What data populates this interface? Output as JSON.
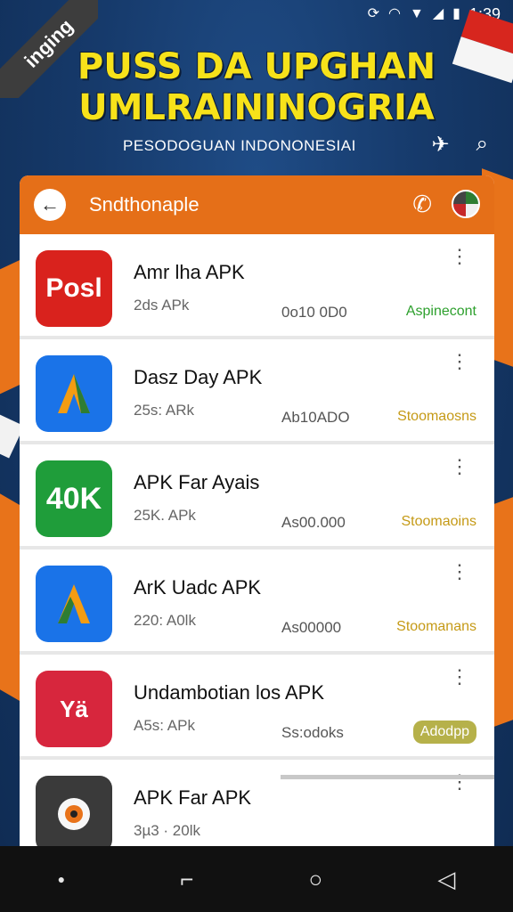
{
  "status_bar": {
    "time": "1:39"
  },
  "ribbon": {
    "label": "inging"
  },
  "hero": {
    "title_line1": "PUSS DA UPGHAN",
    "title_line2": "UMLRAININOGRIA",
    "subtitle": "PESODOGUAN INDONONESIAI"
  },
  "header": {
    "title": "Sndthonaple"
  },
  "apps": [
    {
      "name": "Amr lha APK",
      "size": "2ds APk",
      "date": "0o10 0D0",
      "status": "Aspinecont",
      "status_style": "green",
      "icon_text": "Posl",
      "icon_color": "#d9221d"
    },
    {
      "name": "Dasz Day APK",
      "size": "25s: ARk",
      "date": "Ab10ADO",
      "status": "Stoomaosns",
      "status_style": "gold",
      "icon_text": "A",
      "icon_color": "#1a73e8"
    },
    {
      "name": "APK Far Ayais",
      "size": "25K. APk",
      "date": "As00.000",
      "status": "Stoomaoins",
      "status_style": "gold",
      "icon_text": "40K",
      "icon_color": "#1f9d3a"
    },
    {
      "name": "ArK Uadc APK",
      "size": "220: A0lk",
      "date": "As00000",
      "status": "Stoomanans",
      "status_style": "gold",
      "icon_text": "A",
      "icon_color": "#1a73e8"
    },
    {
      "name": "Undambotian los APK",
      "size": "A5s: APk",
      "date": "Ss:odoks",
      "status": "Adodpp",
      "status_style": "pill",
      "icon_text": "Yä",
      "icon_color": "#d7263d"
    },
    {
      "name": "APK Far APK",
      "size": "3µ3 · 20lk",
      "date": "",
      "status": "",
      "status_style": "none",
      "icon_text": "",
      "icon_color": "#3a3a3a"
    }
  ],
  "icons": {
    "back": "back-arrow-icon",
    "phone": "phone-icon",
    "menu": "more-vert-icon"
  }
}
